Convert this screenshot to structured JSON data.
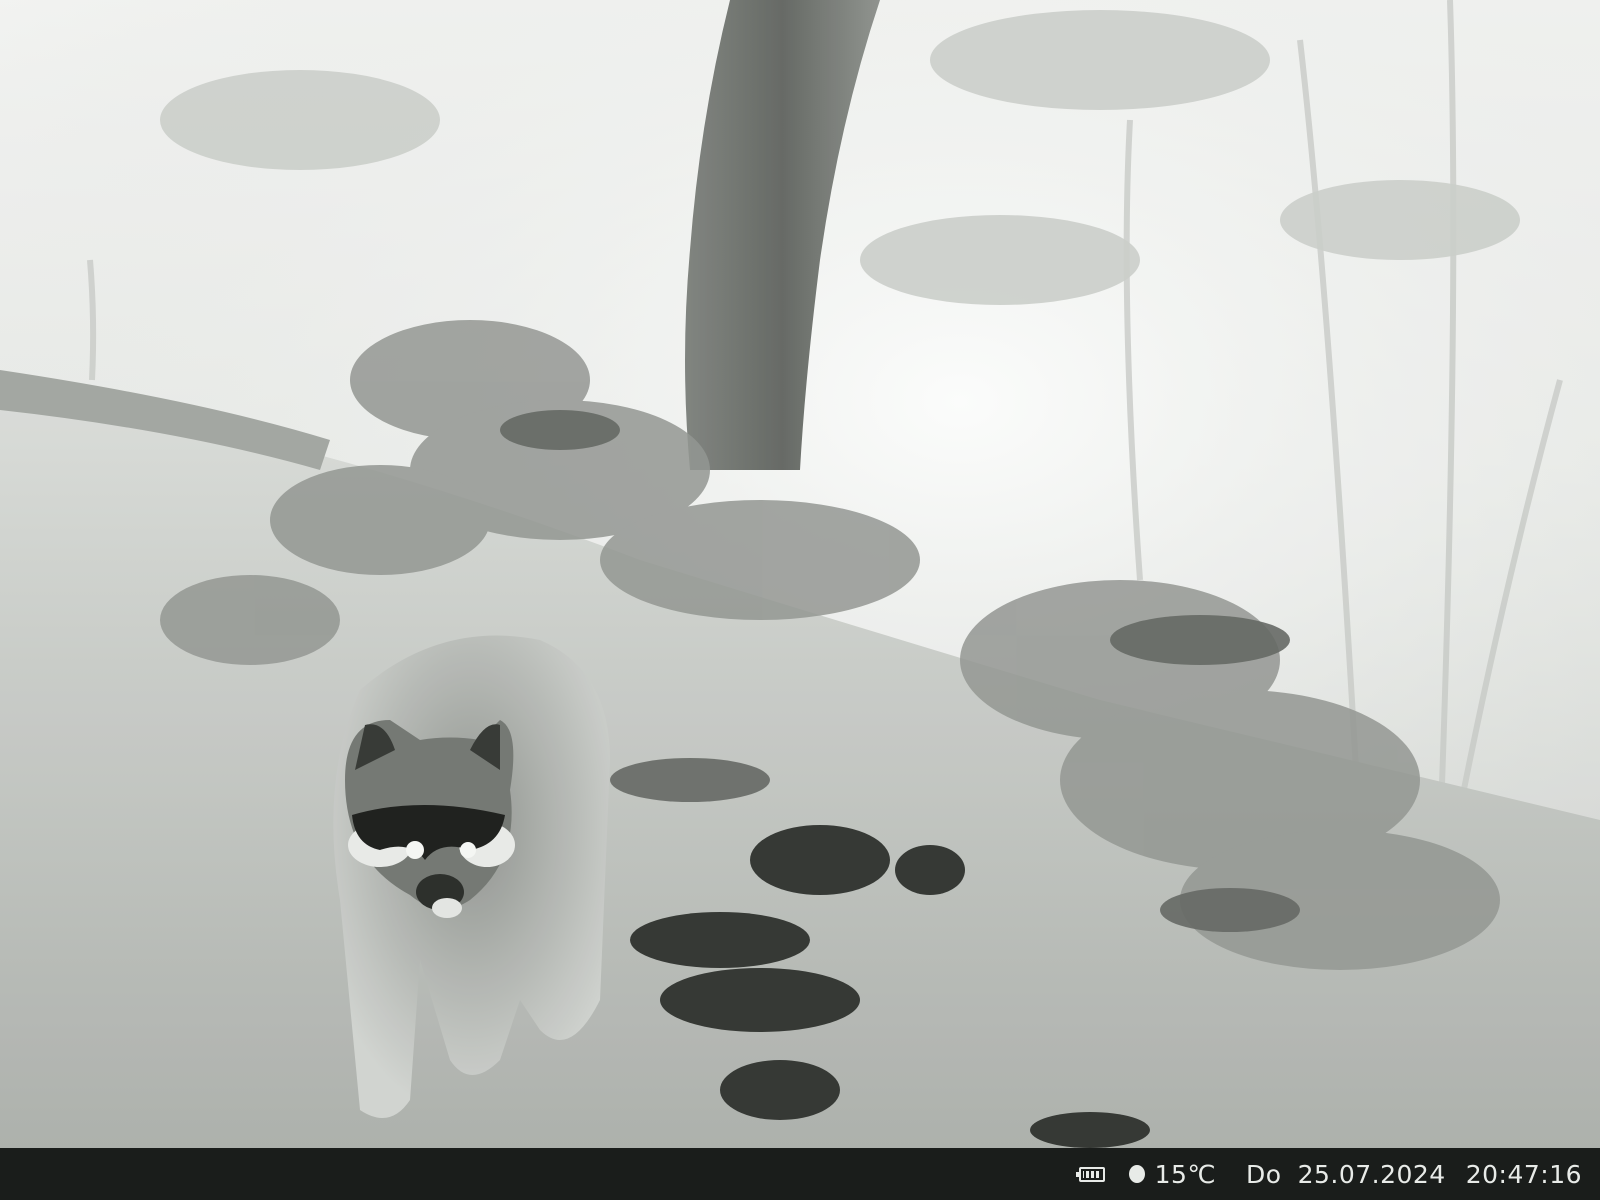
{
  "scene": {
    "subject": "raccoon",
    "icons": [
      "tree-trunk",
      "raccoon",
      "foliage",
      "log"
    ]
  },
  "status_bar": {
    "battery_icon": "battery-icon",
    "moon_icon": "moon-phase-icon",
    "temperature": "15℃",
    "day": "Do",
    "date": "25.07.2024",
    "time": "20:47:16"
  },
  "colors": {
    "status_bar_bg": "#1a1d1b",
    "status_text": "#e8ebe8"
  }
}
